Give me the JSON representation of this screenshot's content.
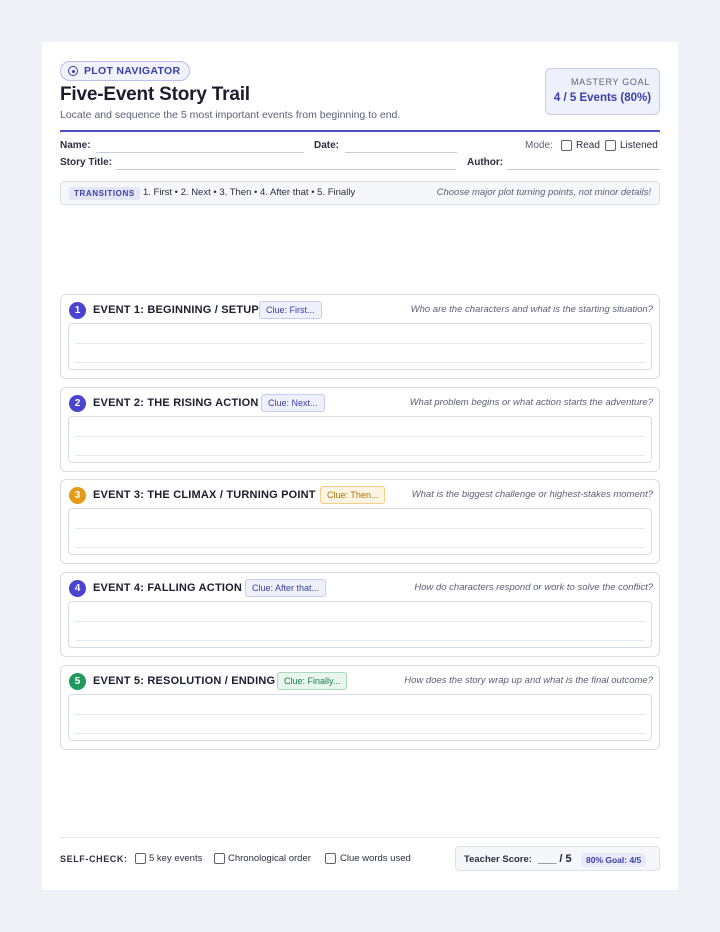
{
  "header": {
    "badge": "PLOT NAVIGATOR",
    "title": "Five-Event Story Trail",
    "subtitle": "Locate and sequence the 5 most important events from beginning to end.",
    "mastery_label": "MASTERY GOAL",
    "mastery_value": "4 / 5 Events (80%)"
  },
  "fields": {
    "name": "Name:",
    "date": "Date:",
    "mode": "Mode:",
    "mode_read": "Read",
    "mode_listened": "Listened",
    "story_title": "Story Title:",
    "author": "Author:"
  },
  "transitions": {
    "tag": "TRANSITIONS",
    "sequence": "1. First • 2. Next • 3. Then • 4. After that • 5. Finally",
    "tip": "Choose major plot turning points, not minor details!"
  },
  "events": [
    {
      "number": "1",
      "title": "EVENT 1: BEGINNING / SETUP",
      "clue": "Clue: First...",
      "question": "Who are the characters and what is the starting situation?",
      "color": "#4a44d0"
    },
    {
      "number": "2",
      "title": "EVENT 2: THE RISING ACTION",
      "clue": "Clue: Next...",
      "question": "What problem begins or what action starts the adventure?",
      "color": "#4a44d0"
    },
    {
      "number": "3",
      "title": "EVENT 3: THE CLIMAX / TURNING POINT",
      "clue": "Clue: Then...",
      "question": "What is the biggest challenge or highest-stakes moment?",
      "color": "#e59a18"
    },
    {
      "number": "4",
      "title": "EVENT 4: FALLING ACTION",
      "clue": "Clue: After that...",
      "question": "How do characters respond or work to solve the conflict?",
      "color": "#4a44d0"
    },
    {
      "number": "5",
      "title": "EVENT 5: RESOLUTION / ENDING",
      "clue": "Clue: Finally...",
      "question": "How does the story wrap up and what is the final outcome?",
      "color": "#1f9a5c"
    }
  ],
  "footer": {
    "self_check": "SELF-CHECK:",
    "checks": [
      "5 key events",
      "Chronological order",
      "Clue words used"
    ],
    "teacher_score_label": "Teacher Score:",
    "teacher_score_value": "___ / 5",
    "goal": "80% Goal: 4/5"
  },
  "colors": {
    "accent": "#4a4fc4",
    "amber": "#e59a18",
    "green": "#1f9a5c"
  }
}
